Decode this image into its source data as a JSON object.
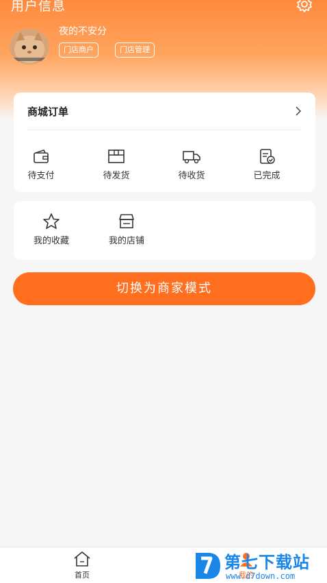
{
  "header": {
    "title": "用户信息",
    "settings_icon": "gear-icon"
  },
  "profile": {
    "username": "夜的不安分",
    "tags": [
      "门店商户",
      "门店管理"
    ]
  },
  "orders": {
    "title": "商城订单",
    "items": [
      {
        "label": "待支付",
        "icon": "wallet-icon"
      },
      {
        "label": "待发货",
        "icon": "package-icon"
      },
      {
        "label": "待收货",
        "icon": "truck-icon"
      },
      {
        "label": "已完成",
        "icon": "checklist-icon"
      }
    ]
  },
  "tools": {
    "items": [
      {
        "label": "我的收藏",
        "icon": "star-icon"
      },
      {
        "label": "我的店铺",
        "icon": "store-icon"
      }
    ]
  },
  "switch_button": "切换为商家模式",
  "tabbar": {
    "items": [
      {
        "label": "首页",
        "icon": "home-icon"
      },
      {
        "label": "我的",
        "icon": "user-icon"
      }
    ]
  },
  "watermark": {
    "title": "第七下载站",
    "url": "www.d7down.com"
  },
  "colors": {
    "accent": "#ff6f1f",
    "header_gradient_top": "#ff8a3d",
    "watermark_blue": "#1a86e8"
  }
}
